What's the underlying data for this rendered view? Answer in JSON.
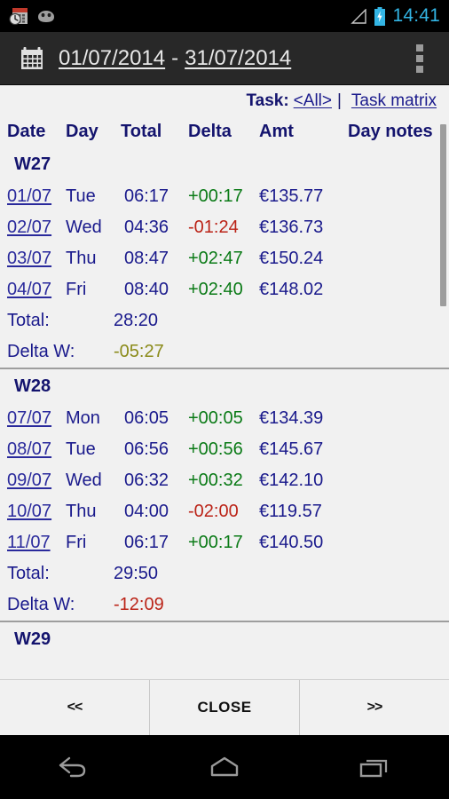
{
  "statusbar": {
    "icons": [
      "calendar-clock-icon",
      "android-head-icon",
      "signal-icon",
      "battery-charging-icon"
    ],
    "clock": "14:41",
    "clock_color": "#33b5e5"
  },
  "titlebar": {
    "calendar_icon": "calendar-icon",
    "date_from": "01/07/2014",
    "date_separator": "-",
    "date_to": "31/07/2014",
    "overflow_icon": "overflow-menu-icon"
  },
  "taskline": {
    "label": "Task:",
    "selected": "<All>",
    "pipe": "|",
    "matrix_link": "Task matrix"
  },
  "columns": {
    "date": "Date",
    "day": "Day",
    "total": "Total",
    "delta": "Delta",
    "amt": "Amt",
    "notes": "Day notes"
  },
  "colors": {
    "header_text": "#14146e",
    "link": "#2a2a9c",
    "positive": "#0a7a16",
    "negative": "#bb2418",
    "olive": "#8a8a18",
    "accent": "#33b5e5"
  },
  "weeks": [
    {
      "label": "W27",
      "rows": [
        {
          "date": "01/07",
          "day": "Tue",
          "total": "06:17",
          "delta": "+00:17",
          "delta_sign": "pos",
          "amt": "€135.77",
          "notes": ""
        },
        {
          "date": "02/07",
          "day": "Wed",
          "total": "04:36",
          "delta": "-01:24",
          "delta_sign": "neg",
          "amt": "€136.73",
          "notes": ""
        },
        {
          "date": "03/07",
          "day": "Thu",
          "total": "08:47",
          "delta": "+02:47",
          "delta_sign": "pos",
          "amt": "€150.24",
          "notes": ""
        },
        {
          "date": "04/07",
          "day": "Fri",
          "total": "08:40",
          "delta": "+02:40",
          "delta_sign": "pos",
          "amt": "€148.02",
          "notes": ""
        }
      ],
      "total_label": "Total:",
      "total_value": "28:20",
      "delta_label": "Delta W:",
      "delta_value": "-05:27",
      "delta_sign": "olive"
    },
    {
      "label": "W28",
      "rows": [
        {
          "date": "07/07",
          "day": "Mon",
          "total": "06:05",
          "delta": "+00:05",
          "delta_sign": "pos",
          "amt": "€134.39",
          "notes": ""
        },
        {
          "date": "08/07",
          "day": "Tue",
          "total": "06:56",
          "delta": "+00:56",
          "delta_sign": "pos",
          "amt": "€145.67",
          "notes": ""
        },
        {
          "date": "09/07",
          "day": "Wed",
          "total": "06:32",
          "delta": "+00:32",
          "delta_sign": "pos",
          "amt": "€142.10",
          "notes": ""
        },
        {
          "date": "10/07",
          "day": "Thu",
          "total": "04:00",
          "delta": "-02:00",
          "delta_sign": "neg",
          "amt": "€119.57",
          "notes": ""
        },
        {
          "date": "11/07",
          "day": "Fri",
          "total": "06:17",
          "delta": "+00:17",
          "delta_sign": "pos",
          "amt": "€140.50",
          "notes": ""
        }
      ],
      "total_label": "Total:",
      "total_value": "29:50",
      "delta_label": "Delta W:",
      "delta_value": "-12:09",
      "delta_sign": "neg"
    },
    {
      "label": "W29",
      "rows": [],
      "total_label": "",
      "total_value": "",
      "delta_label": "",
      "delta_value": "",
      "delta_sign": ""
    }
  ],
  "buttons": {
    "prev": "<<",
    "close": "CLOSE",
    "next": ">>"
  },
  "navbar": {
    "back": "back-icon",
    "home": "home-icon",
    "recents": "recents-icon"
  }
}
